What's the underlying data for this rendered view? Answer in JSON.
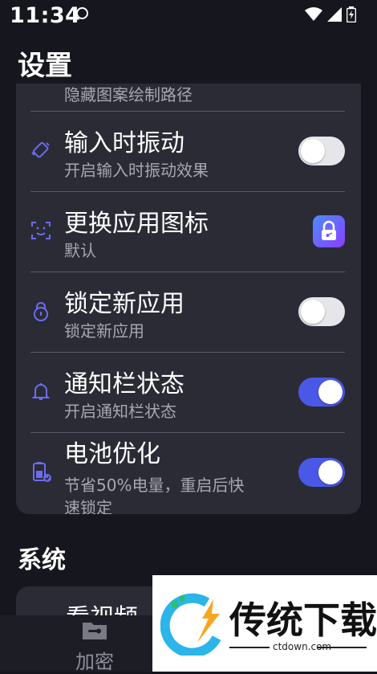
{
  "status_bar": {
    "time": "11:34"
  },
  "header": {
    "title": "设置"
  },
  "settings": {
    "top_partial_subtitle": "隐藏图案绘制路径",
    "items": [
      {
        "title": "输入时振动",
        "subtitle": "开启输入时振动效果",
        "toggle": "off",
        "icon": "vibration-icon"
      },
      {
        "title": "更换应用图标",
        "subtitle": "默认",
        "icon": "face-scan-icon",
        "trailing": "app-lock-icon"
      },
      {
        "title": "锁定新应用",
        "subtitle": "锁定新应用",
        "toggle": "off",
        "icon": "lock-icon"
      },
      {
        "title": "通知栏状态",
        "subtitle": "开启通知栏状态",
        "toggle": "on",
        "icon": "bell-icon"
      },
      {
        "title": "电池优化",
        "subtitle_line1": "节省50%电量，重启后快",
        "subtitle_line2": "速锁定",
        "toggle": "on",
        "icon": "battery-icon"
      }
    ]
  },
  "system": {
    "title": "系统",
    "first_item": "看视频"
  },
  "bottom_nav": {
    "items": [
      {
        "label": "加密",
        "icon": "folder-lock-icon"
      }
    ]
  },
  "watermark": {
    "brand": "传统下载",
    "url": "ctdown.com"
  },
  "colors": {
    "background": "#16161e",
    "card": "#2b2b36",
    "accent": "#4a58e8",
    "icon": "#6b6cf0"
  }
}
